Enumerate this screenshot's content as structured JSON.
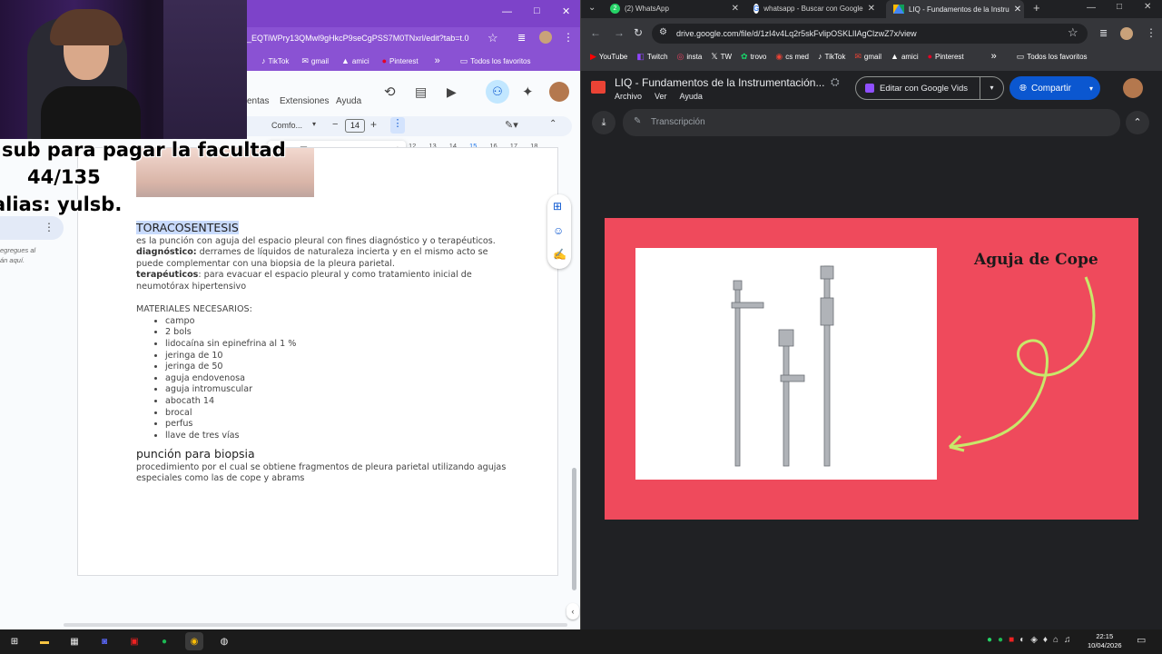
{
  "left": {
    "url": "_EQTiWPry13QMwl9gHkcP9seCgPSS7M0TNxrl/edit?tab=t.0",
    "window_controls": [
      "—",
      "□",
      "✕"
    ],
    "bookmarks": [
      "TikTok",
      "gmail",
      "amici",
      "Pinterest"
    ],
    "bookmarks_more": "»",
    "all_bookmarks": "Todos los favoritos",
    "menu": [
      "entas",
      "Extensiones",
      "Ayuda"
    ],
    "toolbar": {
      "font": "Comfo...",
      "font_size": "14"
    },
    "ruler": [
      "12",
      "13",
      "14",
      "15",
      "16",
      "17",
      "18"
    ],
    "side_comment": [
      "egregues al",
      "án aquí."
    ],
    "doc": {
      "heading": "TORACOSENTESIS",
      "intro": "es la punción con aguja del espacio pleural con fines diagnóstico y o terapéuticos.",
      "diag_label": "diagnóstico:",
      "diag_text": " derrames de líquidos de naturaleza incierta y en el mismo acto se puede complementar con una biopsia de la pleura parietal.",
      "ter_label": "terapéuticos",
      "ter_text": ": para evacuar el espacio pleural y como tratamiento inicial de neumotórax hipertensivo",
      "materials_title": "MATERIALES NECESARIOS:",
      "materials": [
        "campo",
        "2 bols",
        "lidocaína sin epinefrina al 1 %",
        "jeringa de 10",
        "jeringa de 50",
        "aguja endovenosa",
        "aguja intromuscular",
        "abocath 14",
        "brocal",
        "perfus",
        "llave de tres vías"
      ],
      "subheading": "punción para biopsia",
      "sub_text": "procedimiento por el cual se obtiene fragmentos de pleura parietal utilizando agujas especiales como las de cope y abrams"
    }
  },
  "overlay": {
    "line1": "sub para pagar la facultad",
    "line2": "44/135",
    "line3": "alias: yulsb."
  },
  "right": {
    "tabs": [
      {
        "label": "(2) WhatsApp",
        "badge": "2"
      },
      {
        "label": "whatsapp - Buscar con Google"
      },
      {
        "label": "LIQ - Fundamentos de la Instru"
      }
    ],
    "new_tab": "+",
    "window_controls": [
      "—",
      "□",
      "✕"
    ],
    "url": "drive.google.com/file/d/1zI4v4Lq2r5skFvlipOSKLlIAgClzwZ7x/view",
    "bookmarks": [
      "YouTube",
      "Twitch",
      "insta",
      "TW",
      "trovo",
      "cs med",
      "TikTok",
      "gmail",
      "amici",
      "Pinterest"
    ],
    "bookmarks_more": "»",
    "all_bookmarks": "Todos los favoritos",
    "file_title": "LIQ - Fundamentos de la Instrumentación...",
    "file_menu": [
      "Archivo",
      "Ver",
      "Ayuda"
    ],
    "edit_button": "Editar con Google Vids",
    "share_button": "Compartir",
    "transcript_label": "Transcripción",
    "slide_title": "Aguja de Cope"
  },
  "taskbar": {
    "time": "22:15",
    "date": "10/04/2026"
  },
  "colors": {
    "chrome_purple": "#7d43c9",
    "slide_red": "#ef4a5c",
    "share_blue": "#0b57d0"
  }
}
